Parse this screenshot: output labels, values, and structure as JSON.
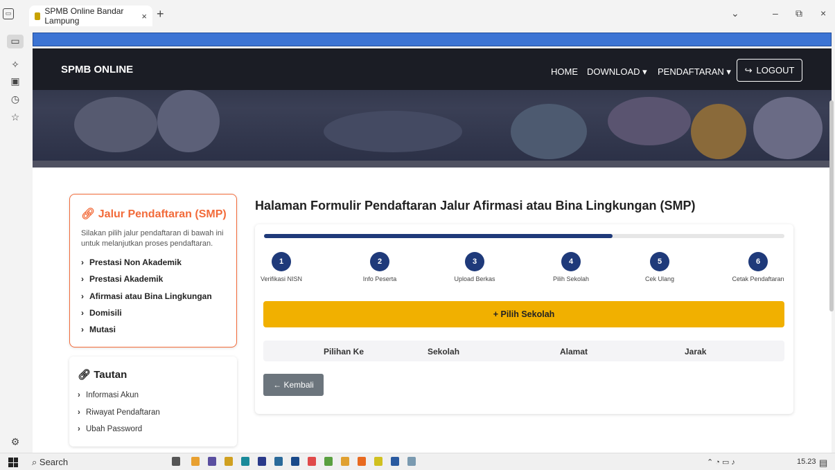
{
  "browser": {
    "tab_title": "SPMB Online Bandar Lampung",
    "tab_close": "×",
    "new_tab": "+",
    "min": "–",
    "restore": "⧉",
    "close": "×",
    "dropdown": "⌄"
  },
  "header": {
    "brand": "SPMB ONLINE",
    "nav": {
      "home": "HOME",
      "download": "DOWNLOAD ▾",
      "pendaftaran": "PENDAFTARAN ▾"
    },
    "logout": "LOGOUT",
    "logout_icon": "↪"
  },
  "side_menu": {
    "title": "Jalur Pendaftaran (SMP)",
    "description": "Silakan pilih jalur pendaftaran di bawah ini untuk melanjutkan proses pendaftaran.",
    "items": [
      "Prestasi Non Akademik",
      "Prestasi Akademik",
      "Afirmasi atau Bina Lingkungan",
      "Domisili",
      "Mutasi"
    ]
  },
  "tautan": {
    "title": "Tautan",
    "items": [
      "Informasi Akun",
      "Riwayat Pendaftaran",
      "Ubah Password"
    ]
  },
  "main": {
    "title": "Halaman Formulir Pendaftaran Jalur Afirmasi atau Bina Lingkungan (SMP)",
    "progress_fraction": 0.67,
    "steps": [
      {
        "num": "1",
        "label": "Verifikasi NISN"
      },
      {
        "num": "2",
        "label": "Info Peserta"
      },
      {
        "num": "3",
        "label": "Upload Berkas"
      },
      {
        "num": "4",
        "label": "Pilih Sekolah"
      },
      {
        "num": "5",
        "label": "Cek Ulang"
      },
      {
        "num": "6",
        "label": "Cetak Pendaftaran"
      }
    ],
    "pilih_button": "+ Pilih Sekolah",
    "table_headers": [
      "Pilihan Ke",
      "Sekolah",
      "Alamat",
      "Jarak"
    ],
    "back_button": "← Kembali"
  },
  "taskbar": {
    "search": "Search",
    "time": "15.23"
  },
  "colors": {
    "accent_orange": "#f26b3a",
    "navy": "#1f3a7a",
    "yellow": "#f1b000",
    "gray_button": "#6c757d"
  }
}
